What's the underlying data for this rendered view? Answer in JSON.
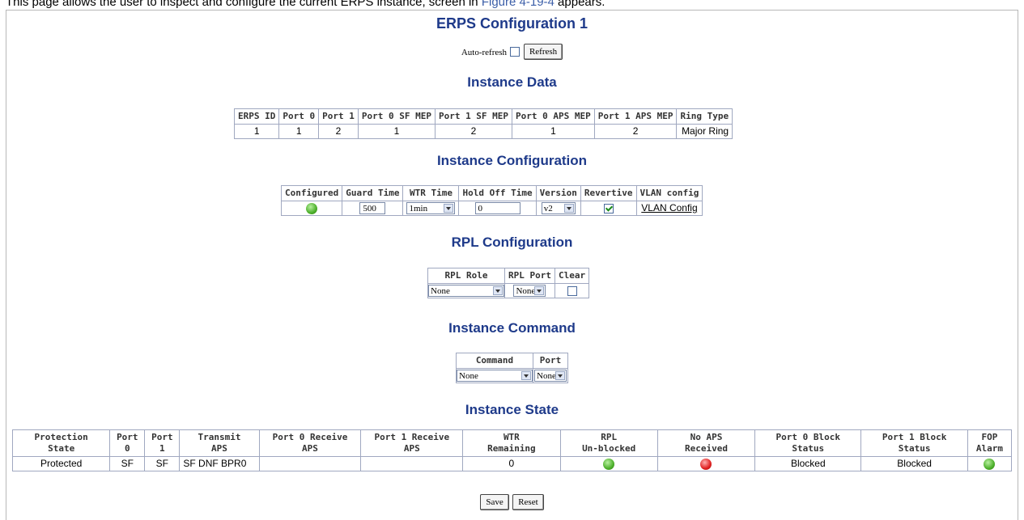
{
  "intro": {
    "text_before": "This page allows the user to inspect and configure the current ERPS instance, screen in ",
    "link": "Figure 4-19-4",
    "text_after": " appears."
  },
  "title": "ERPS Configuration 1",
  "auto_refresh_label": "Auto-refresh",
  "refresh_button": "Refresh",
  "instance_data": {
    "heading": "Instance Data",
    "columns": [
      "ERPS ID",
      "Port 0",
      "Port 1",
      "Port 0 SF MEP",
      "Port 1 SF MEP",
      "Port 0 APS MEP",
      "Port 1 APS MEP",
      "Ring Type"
    ],
    "row": [
      "1",
      "1",
      "2",
      "1",
      "2",
      "1",
      "2",
      "Major Ring"
    ]
  },
  "instance_configuration": {
    "heading": "Instance Configuration",
    "columns": [
      "Configured",
      "Guard Time",
      "WTR Time",
      "Hold Off Time",
      "Version",
      "Revertive",
      "VLAN config"
    ],
    "guard_time": "500",
    "wtr_time": "1min",
    "hold_off_time": "0",
    "version": "v2",
    "revertive_checked": true,
    "vlan_link": "VLAN Config",
    "configured_status": "green"
  },
  "rpl_configuration": {
    "heading": "RPL Configuration",
    "columns": [
      "RPL Role",
      "RPL Port",
      "Clear"
    ],
    "role": "None",
    "port": "None"
  },
  "instance_command": {
    "heading": "Instance Command",
    "columns": [
      "Command",
      "Port"
    ],
    "command": "None",
    "port": "None"
  },
  "instance_state": {
    "heading": "Instance State",
    "columns": [
      [
        "Protection",
        "State"
      ],
      [
        "Port",
        "0"
      ],
      [
        "Port",
        "1"
      ],
      [
        "Transmit",
        "APS"
      ],
      [
        "Port 0 Receive",
        "APS"
      ],
      [
        "Port 1 Receive",
        "APS"
      ],
      [
        "WTR",
        "Remaining"
      ],
      [
        "RPL",
        "Un-blocked"
      ],
      [
        "No APS",
        "Received"
      ],
      [
        "Port 0 Block",
        "Status"
      ],
      [
        "Port 1 Block",
        "Status"
      ],
      [
        "FOP",
        "Alarm"
      ]
    ],
    "row": {
      "protection_state": "Protected",
      "port0": "SF",
      "port1": "SF",
      "transmit_aps": "SF DNF BPR0",
      "port0_receive_aps": "",
      "port1_receive_aps": "",
      "wtr_remaining": "0",
      "rpl_unblocked": "green",
      "no_aps_received": "red",
      "port0_block_status": "Blocked",
      "port1_block_status": "Blocked",
      "fop_alarm": "green"
    }
  },
  "save_button": "Save",
  "reset_button": "Reset"
}
